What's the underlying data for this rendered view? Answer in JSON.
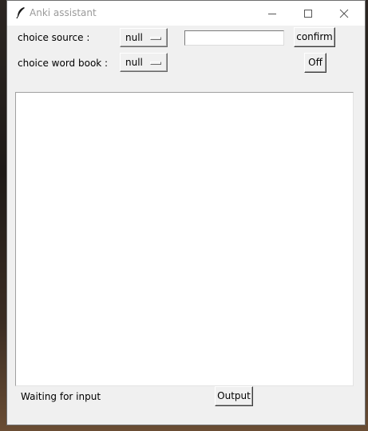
{
  "window": {
    "title": "Anki assistant",
    "icon": "feather-icon",
    "controls": [
      "minimize-icon",
      "maximize-icon",
      "close-icon"
    ]
  },
  "source": {
    "label": "choice source :",
    "selected": "null",
    "input_value": "",
    "confirm_label": "confirm"
  },
  "wordbook": {
    "label": "choice word book :",
    "selected": "null",
    "off_label": "Off"
  },
  "output_area": {
    "content": ""
  },
  "footer": {
    "status": "Waiting for input",
    "output_label": "Output"
  },
  "colors": {
    "window_bg": "#f0f0f0",
    "titlebar_bg": "#ffffff",
    "title_text": "#9a9a9a",
    "text_area_bg": "#ffffff"
  }
}
